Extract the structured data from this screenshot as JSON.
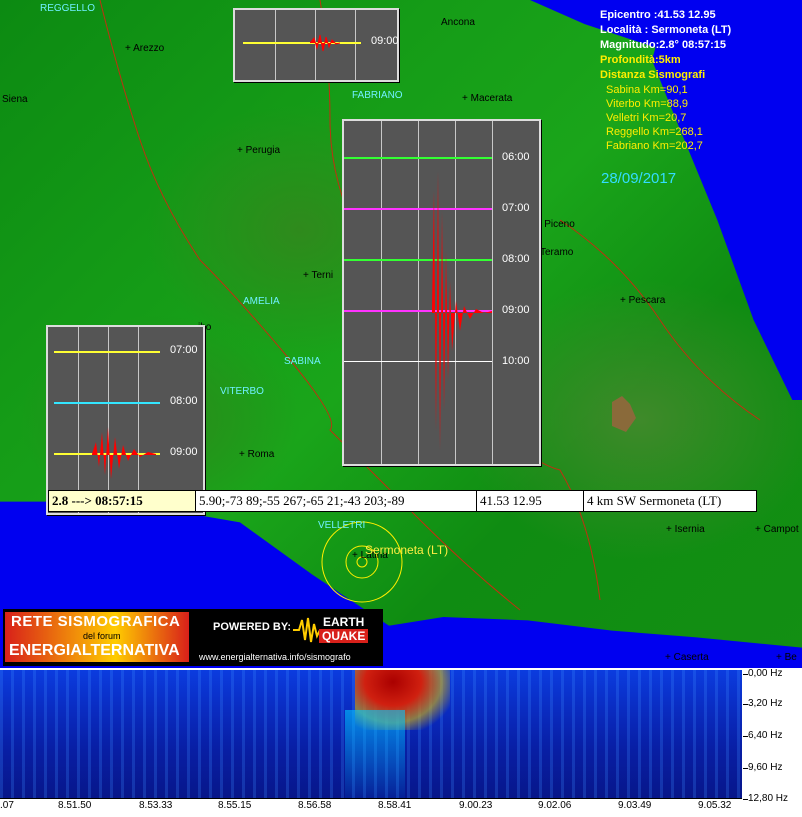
{
  "info": {
    "epicentro": "Epicentro :41.53 12.95",
    "localita": "Località : Sermoneta (LT)",
    "magnitudo": "Magnitudo:2.8°  08:57:15",
    "profondita": "Profondità:5km",
    "dist_title": "Distanza Sismografi",
    "distances": [
      "Sabina Km=90,1",
      "Viterbo Km=88,9",
      "Velletri Km=20,7",
      "Reggello Km=268,1",
      "Fabriano Km=202,7"
    ],
    "date": "28/09/2017"
  },
  "cities": {
    "reggello": "REGGELLO",
    "arezzo": "+ Arezzo",
    "siena": "Siena",
    "fabriano": "FABRIANO",
    "macerata": "+ Macerata",
    "perugia": "+ Perugia",
    "terni": "+ Terni",
    "amelia": "AMELIA",
    "sabina": "SABINA",
    "viterbo": "VITERBO",
    "roma": "+ Roma",
    "velletri": "VELLETRI",
    "latina": "+ Latina",
    "sermoneta": "Sermoneta (LT)",
    "pescara": "+ Pescara",
    "teramo": "Teramo",
    "piceno": "li Piceno",
    "isernia": "+ Isernia",
    "campob": "+ Campot",
    "caserta": "+ Caserta",
    "be": "+ Be",
    "ancona": "Ancona",
    "orvieto": "ibo"
  },
  "panel_small": {
    "time": "09:00"
  },
  "panel_big": {
    "times": [
      "06:00",
      "07:00",
      "08:00",
      "09:00",
      "10:00"
    ]
  },
  "panel_left": {
    "times": [
      "07:00",
      "08:00",
      "09:00"
    ]
  },
  "strip": {
    "mag_time": "2.8 ---> 08:57:15",
    "values": "5.90;-73 89;-55 267;-65 21;-43 203;-89",
    "coords": "41.53 12.95",
    "location": "4 km SW Sermoneta (LT)"
  },
  "banner": {
    "line1": "RETE SISMOGRAFICA",
    "line2": "del forum",
    "line3": "ENERGIALTERNATIVA",
    "powered": "POWERED BY:",
    "earth": "EARTH",
    "quake": "QUAKE",
    "url": "www.energialternativa.info/sismografo"
  },
  "spectrogram": {
    "freqs": [
      "0,00 Hz",
      "3,20 Hz",
      "6,40 Hz",
      "9,60 Hz",
      "12,80 Hz"
    ],
    "times": [
      ".07",
      "8.51.50",
      "8.53.33",
      "8.55.15",
      "8.56.58",
      "8.58.41",
      "9.00.23",
      "9.02.06",
      "9.03.49",
      "9.05.32"
    ]
  },
  "colors": {
    "panel_bg": "#555555",
    "trace_red": "#ff0000",
    "trace_yellow": "#ffff33",
    "trace_cyan": "#33e6ff",
    "trace_green": "#33ff33",
    "trace_magenta": "#ff33ff"
  }
}
